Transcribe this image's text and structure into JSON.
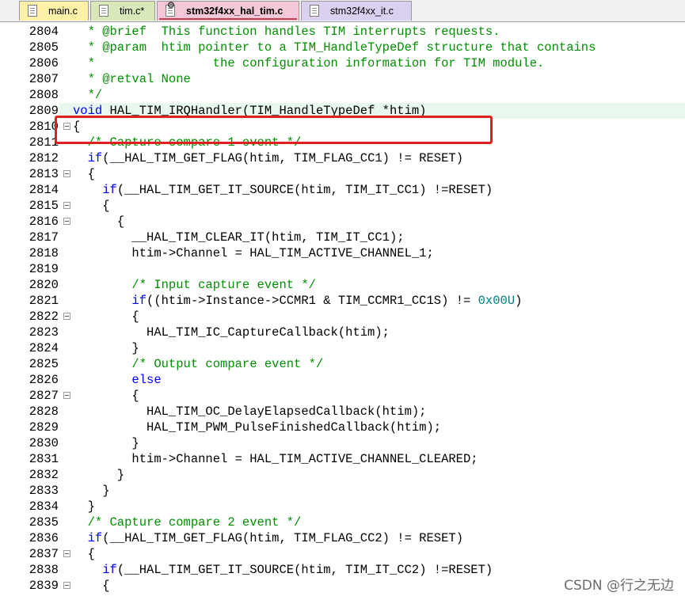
{
  "tabs": [
    {
      "label": "main.c",
      "active": false,
      "color": "#fff2a8",
      "icon": "file-icon"
    },
    {
      "label": "tim.c*",
      "active": false,
      "color": "#d8e8b8",
      "icon": "file-icon"
    },
    {
      "label": "stm32f4xx_hal_tim.c",
      "active": true,
      "color": "#f4c8d8",
      "icon": "file-gear-icon"
    },
    {
      "label": "stm32f4xx_it.c",
      "active": false,
      "color": "#dcd0f0",
      "icon": "file-icon"
    }
  ],
  "editor": {
    "current_line": "2809",
    "lines": [
      {
        "n": "2804",
        "text": "  * @brief  This function handles TIM interrupts requests."
      },
      {
        "n": "2805",
        "text": "  * @param  htim pointer to a TIM_HandleTypeDef structure that contains"
      },
      {
        "n": "2806",
        "text": "  *                the configuration information for TIM module."
      },
      {
        "n": "2807",
        "text": "  * @retval None"
      },
      {
        "n": "2808",
        "text": "  */"
      },
      {
        "n": "2809",
        "text": "void HAL_TIM_IRQHandler(TIM_HandleTypeDef *htim)"
      },
      {
        "n": "2810",
        "text": "{"
      },
      {
        "n": "2811",
        "text": "  /* Capture compare 1 event */"
      },
      {
        "n": "2812",
        "text": "  if(__HAL_TIM_GET_FLAG(htim, TIM_FLAG_CC1) != RESET)"
      },
      {
        "n": "2813",
        "text": "  {"
      },
      {
        "n": "2814",
        "text": "    if(__HAL_TIM_GET_IT_SOURCE(htim, TIM_IT_CC1) !=RESET)"
      },
      {
        "n": "2815",
        "text": "    {"
      },
      {
        "n": "2816",
        "text": "      {"
      },
      {
        "n": "2817",
        "text": "        __HAL_TIM_CLEAR_IT(htim, TIM_IT_CC1);"
      },
      {
        "n": "2818",
        "text": "        htim->Channel = HAL_TIM_ACTIVE_CHANNEL_1;"
      },
      {
        "n": "2819",
        "text": ""
      },
      {
        "n": "2820",
        "text": "        /* Input capture event */"
      },
      {
        "n": "2821",
        "text": "        if((htim->Instance->CCMR1 & TIM_CCMR1_CC1S) != 0x00U)"
      },
      {
        "n": "2822",
        "text": "        {"
      },
      {
        "n": "2823",
        "text": "          HAL_TIM_IC_CaptureCallback(htim);"
      },
      {
        "n": "2824",
        "text": "        }"
      },
      {
        "n": "2825",
        "text": "        /* Output compare event */"
      },
      {
        "n": "2826",
        "text": "        else"
      },
      {
        "n": "2827",
        "text": "        {"
      },
      {
        "n": "2828",
        "text": "          HAL_TIM_OC_DelayElapsedCallback(htim);"
      },
      {
        "n": "2829",
        "text": "          HAL_TIM_PWM_PulseFinishedCallback(htim);"
      },
      {
        "n": "2830",
        "text": "        }"
      },
      {
        "n": "2831",
        "text": "        htim->Channel = HAL_TIM_ACTIVE_CHANNEL_CLEARED;"
      },
      {
        "n": "2832",
        "text": "      }"
      },
      {
        "n": "2833",
        "text": "    }"
      },
      {
        "n": "2834",
        "text": "  }"
      },
      {
        "n": "2835",
        "text": "  /* Capture compare 2 event */"
      },
      {
        "n": "2836",
        "text": "  if(__HAL_TIM_GET_FLAG(htim, TIM_FLAG_CC2) != RESET)"
      },
      {
        "n": "2837",
        "text": "  {"
      },
      {
        "n": "2838",
        "text": "    if(__HAL_TIM_GET_IT_SOURCE(htim, TIM_IT_CC2) !=RESET)"
      },
      {
        "n": "2839",
        "text": "    {"
      }
    ],
    "fold_lines": [
      "2810",
      "2813",
      "2815",
      "2816",
      "2822",
      "2827",
      "2837",
      "2839"
    ]
  },
  "colors": {
    "comment": "#009000",
    "keyword": "#0000ff",
    "number": "#008080",
    "highlight_box": "#e02020",
    "current_line_bg": "#e8f8ee"
  },
  "watermark": "CSDN @行之无边"
}
